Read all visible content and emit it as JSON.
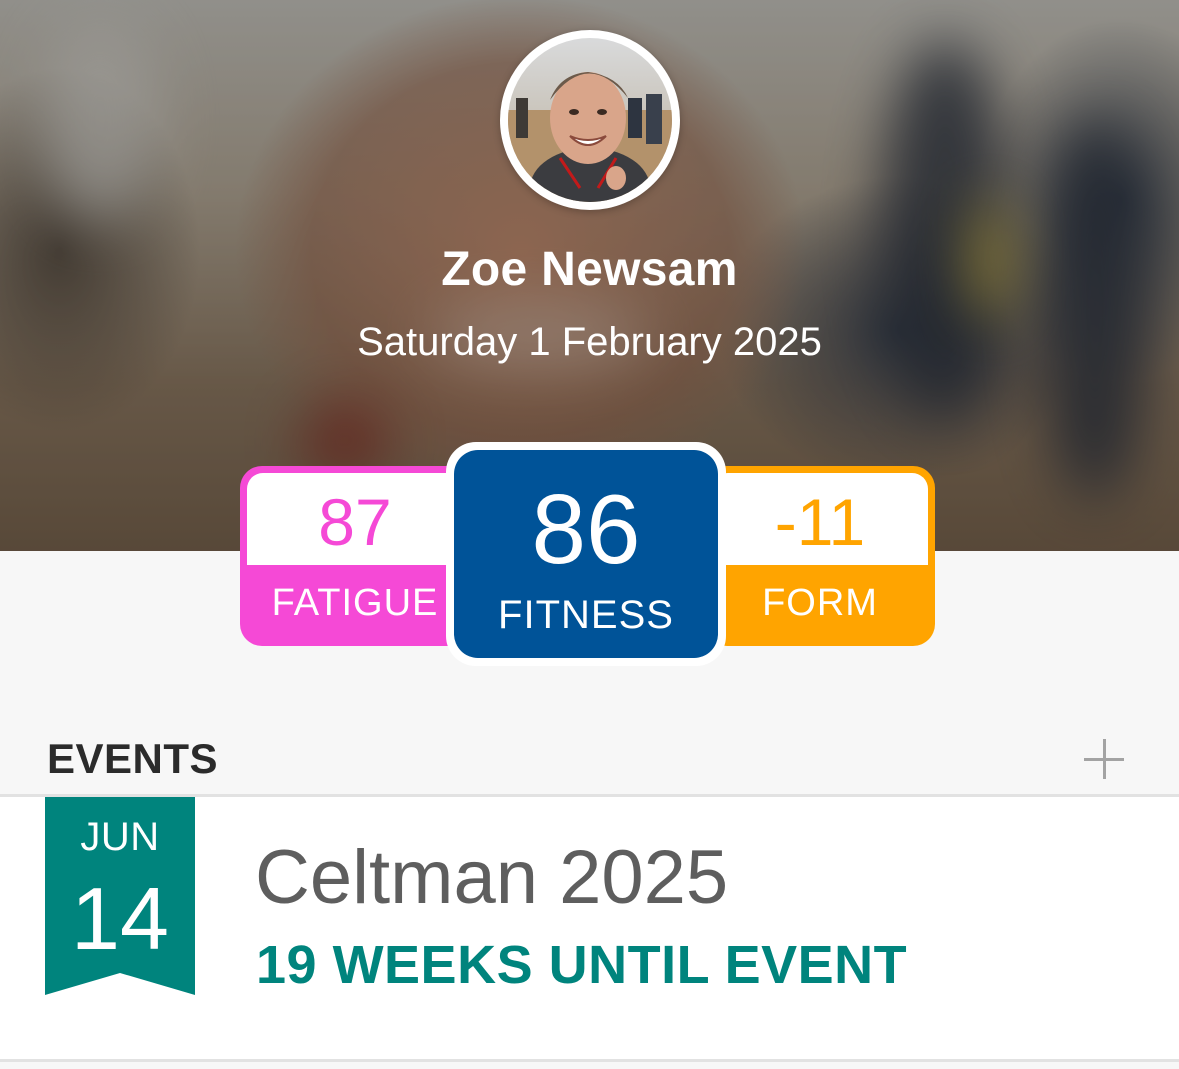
{
  "profile": {
    "name": "Zoe Newsam",
    "date": "Saturday 1 February 2025"
  },
  "metrics": {
    "fatigue": {
      "value": "87",
      "label": "FATIGUE",
      "color": "#f549d6"
    },
    "fitness": {
      "value": "86",
      "label": "FITNESS",
      "color": "#005398"
    },
    "form": {
      "value": "-11",
      "label": "FORM",
      "color": "#ffa400"
    }
  },
  "events": {
    "title": "EVENTS",
    "add_icon": "plus-icon",
    "items": [
      {
        "month": "JUN",
        "day": "14",
        "name": "Celtman 2025",
        "countdown": "19 WEEKS UNTIL EVENT",
        "accent": "#00847d"
      }
    ]
  }
}
